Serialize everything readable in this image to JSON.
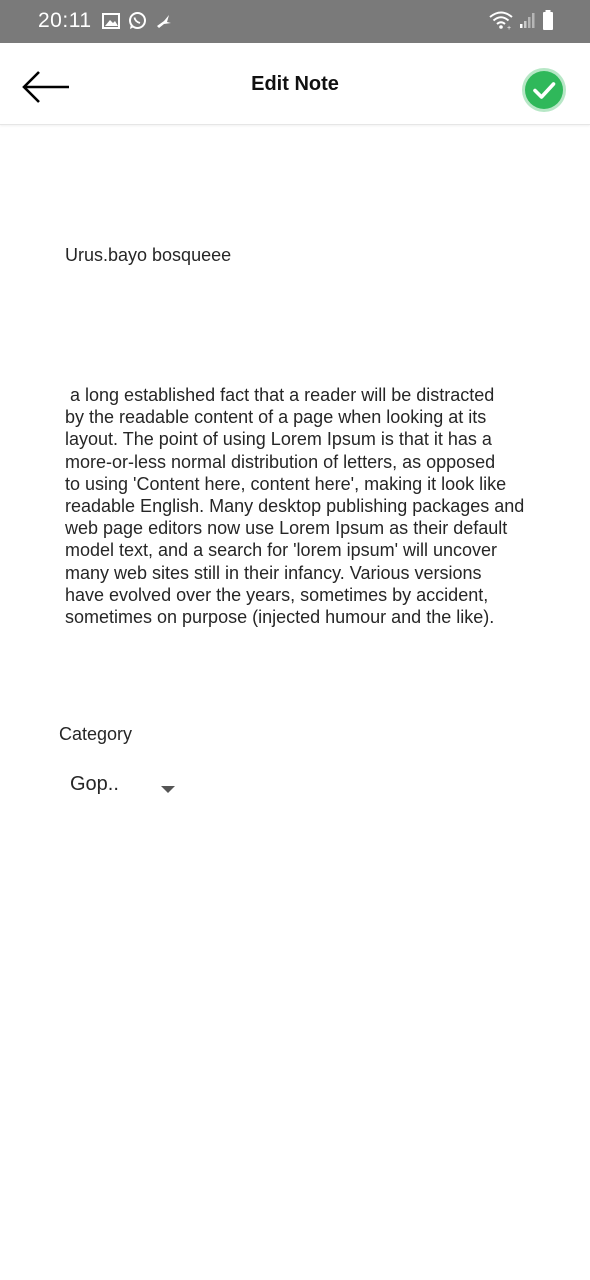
{
  "status_bar": {
    "time": "20:11",
    "icons_left": [
      "gallery-icon",
      "whatsapp-icon",
      "bird-icon"
    ],
    "icons_right": [
      "wifi-icon",
      "signal-icon",
      "battery-icon"
    ]
  },
  "header": {
    "title": "Edit Note",
    "back_icon": "arrow-left-icon",
    "save_icon": "check-circle-icon"
  },
  "note": {
    "title": "Urus.bayo bosqueee",
    "body": " a long established fact that a reader will be distracted\nby the readable content of a page when looking at its\nlayout. The point of using Lorem Ipsum is that it has a\nmore-or-less normal distribution of letters, as opposed\nto using 'Content here, content here', making it look like\nreadable English. Many desktop publishing packages and\nweb page editors now use Lorem Ipsum as their default\nmodel text, and a search for 'lorem ipsum' will uncover\nmany web sites still in their infancy. Various versions\nhave evolved over the years, sometimes by accident,\nsometimes on purpose (injected humour and the like)."
  },
  "category": {
    "label": "Category",
    "selected": "Gop.."
  },
  "colors": {
    "status_bar": "#7a7a7a",
    "accent_green": "#2fb85a",
    "text": "#262626"
  }
}
